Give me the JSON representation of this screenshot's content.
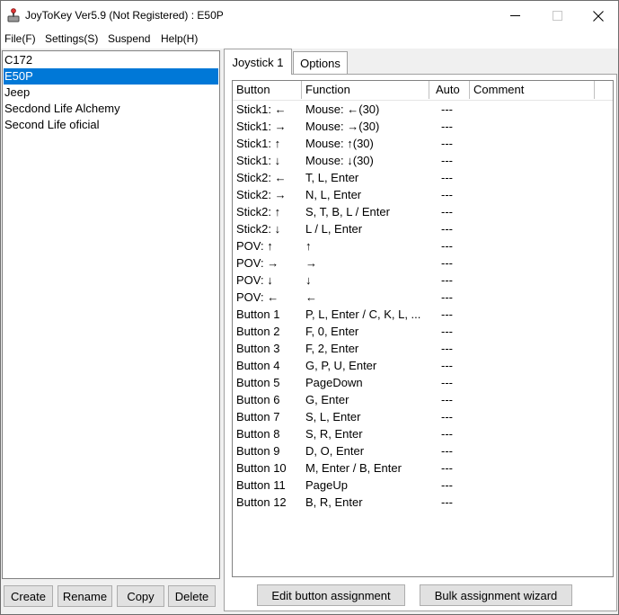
{
  "window": {
    "title": "JoyToKey Ver5.9 (Not Registered) : E50P"
  },
  "menu": [
    "File(F)",
    "Settings(S)",
    "Suspend",
    "Help(H)"
  ],
  "configs": [
    {
      "label": "C172",
      "selected": false
    },
    {
      "label": "E50P",
      "selected": true
    },
    {
      "label": "Jeep",
      "selected": false
    },
    {
      "label": "Secdond Life Alchemy",
      "selected": false
    },
    {
      "label": "Second Life oficial",
      "selected": false
    }
  ],
  "left_buttons": [
    "Create",
    "Rename",
    "Copy",
    "Delete"
  ],
  "tabs": [
    {
      "label": "Joystick 1",
      "active": true
    },
    {
      "label": "Options",
      "active": false
    }
  ],
  "columns": [
    "Button",
    "Function",
    "Auto",
    "Comment"
  ],
  "rows": [
    {
      "button": "Stick1: ←",
      "function": "Mouse: ←(30)",
      "auto": "---"
    },
    {
      "button": "Stick1: →",
      "function": "Mouse: →(30)",
      "auto": "---"
    },
    {
      "button": "Stick1: ↑",
      "function": "Mouse: ↑(30)",
      "auto": "---"
    },
    {
      "button": "Stick1: ↓",
      "function": "Mouse: ↓(30)",
      "auto": "---"
    },
    {
      "button": "Stick2: ←",
      "function": "T, L, Enter",
      "auto": "---"
    },
    {
      "button": "Stick2: →",
      "function": "N, L, Enter",
      "auto": "---"
    },
    {
      "button": "Stick2: ↑",
      "function": "S, T, B, L / Enter",
      "auto": "---"
    },
    {
      "button": "Stick2: ↓",
      "function": "L / L, Enter",
      "auto": "---"
    },
    {
      "button": "POV: ↑",
      "function": "↑",
      "auto": "---"
    },
    {
      "button": "POV: →",
      "function": "→",
      "auto": "---"
    },
    {
      "button": "POV: ↓",
      "function": "↓",
      "auto": "---"
    },
    {
      "button": "POV: ←",
      "function": "←",
      "auto": "---"
    },
    {
      "button": "Button 1",
      "function": "P, L, Enter / C, K, L, ...",
      "auto": "---"
    },
    {
      "button": "Button 2",
      "function": "F, 0, Enter",
      "auto": "---"
    },
    {
      "button": "Button 3",
      "function": "F, 2, Enter",
      "auto": "---"
    },
    {
      "button": "Button 4",
      "function": "G, P, U, Enter",
      "auto": "---"
    },
    {
      "button": "Button 5",
      "function": "PageDown",
      "auto": "---"
    },
    {
      "button": "Button 6",
      "function": "G, Enter",
      "auto": "---"
    },
    {
      "button": "Button 7",
      "function": "S, L, Enter",
      "auto": "---"
    },
    {
      "button": "Button 8",
      "function": "S, R, Enter",
      "auto": "---"
    },
    {
      "button": "Button 9",
      "function": "D, O, Enter",
      "auto": "---"
    },
    {
      "button": "Button 10",
      "function": "M, Enter / B, Enter",
      "auto": "---"
    },
    {
      "button": "Button 11",
      "function": "PageUp",
      "auto": "---"
    },
    {
      "button": "Button 12",
      "function": "B, R, Enter",
      "auto": "---"
    }
  ],
  "bottom_buttons": {
    "edit": "Edit button assignment",
    "bulk": "Bulk assignment wizard"
  },
  "colors": {
    "selection": "#0078d7",
    "button_face": "#e1e1e1",
    "window_bg": "#f0f0f0"
  }
}
